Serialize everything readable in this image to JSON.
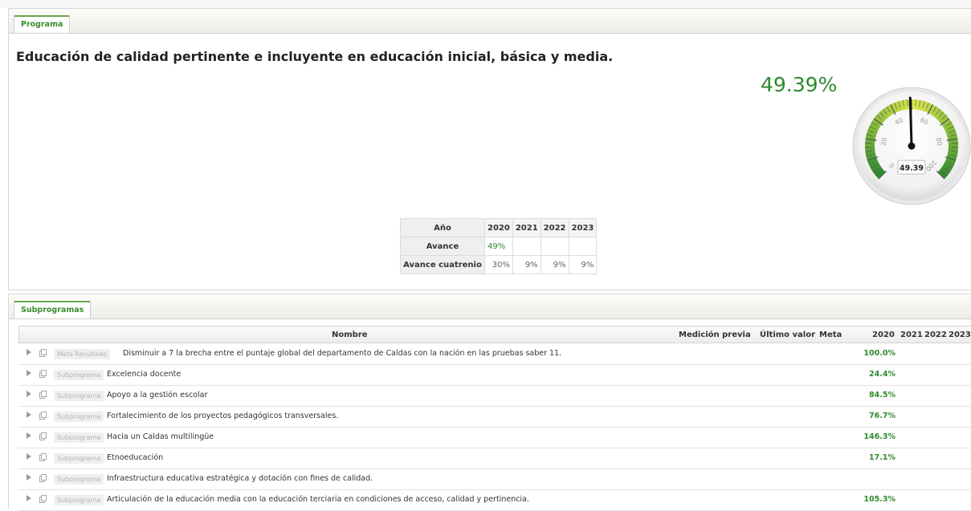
{
  "programa": {
    "tab_label": "Programa",
    "title": "Educación de calidad pertinente e incluyente en educación inicial, básica y media.",
    "percent_label": "49.39%",
    "gauge": {
      "value": 49.39,
      "value_label": "49.39",
      "min": 0,
      "max": 100,
      "tick_labels": [
        "0",
        "20",
        "40",
        "60",
        "80",
        "100"
      ],
      "colors": {
        "low": "#2d8a2d",
        "high": "#d8e64a",
        "needle": "#111111"
      }
    },
    "years_table": {
      "corner_label": "Año",
      "years": [
        "2020",
        "2021",
        "2022",
        "2023"
      ],
      "rows": [
        {
          "label": "Avance",
          "values": [
            "49%",
            "",
            "",
            ""
          ]
        },
        {
          "label": "Avance cuatrenio",
          "values": [
            "30%",
            "9%",
            "9%",
            "9%"
          ]
        }
      ]
    }
  },
  "subprogramas": {
    "tab_label": "Subprogramas",
    "columns": {
      "nombre": "Nombre",
      "medicion_previa": "Medición previa",
      "ultimo_valor": "Último valor",
      "meta": "Meta",
      "years": [
        "2020",
        "2021",
        "2022",
        "2023"
      ]
    },
    "rows": [
      {
        "badge": "Meta Resultado",
        "name": "Disminuir a 7 la brecha entre el puntaje global del departamento de Caldas con la nación en las pruebas saber 11.",
        "v2020": "100.0%"
      },
      {
        "badge": "Subprograma",
        "name": "Excelencia docente",
        "v2020": "24.4%"
      },
      {
        "badge": "Subprograma",
        "name": "Apoyo a la gestión escolar",
        "v2020": "84.5%"
      },
      {
        "badge": "Subprograma",
        "name": "Fortalecimiento de los proyectos pedagógicos transversales.",
        "v2020": "76.7%"
      },
      {
        "badge": "Subprograma",
        "name": "Hacia un Caldas multilingüe",
        "v2020": "146.3%"
      },
      {
        "badge": "Subprograma",
        "name": "Etnoeducación",
        "v2020": "17.1%"
      },
      {
        "badge": "Subprograma",
        "name": "Infraestructura educativa estratégica y dotación con fines de calidad.",
        "v2020": ""
      },
      {
        "badge": "Subprograma",
        "name": "Articulación de la educación media con la educación terciaria en condiciones de acceso, calidad y pertinencia.",
        "v2020": "105.3%"
      }
    ]
  }
}
